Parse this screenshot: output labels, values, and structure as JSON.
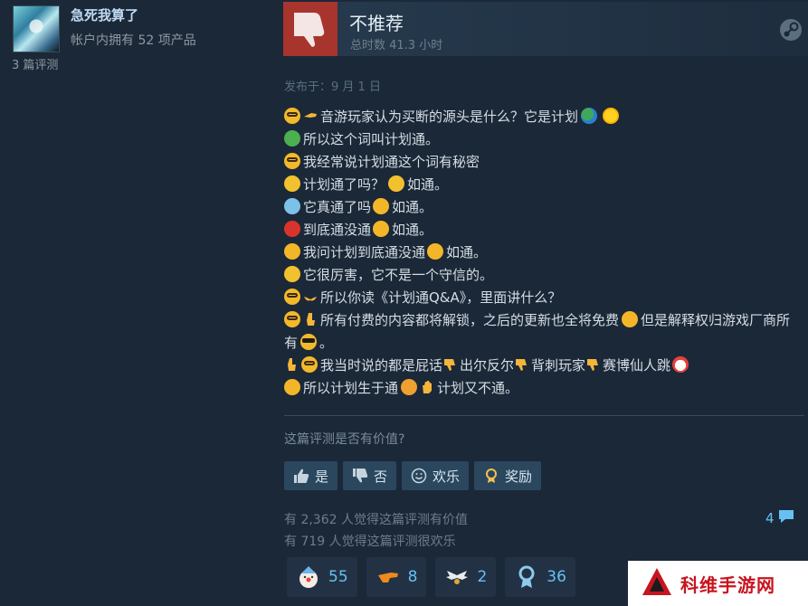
{
  "author": {
    "name": "急死我算了",
    "products": "帐户内拥有 52 项产品",
    "reviews": "3 篇评测"
  },
  "review": {
    "verdict": "不推荐",
    "hours": "总时数 41.3 小时",
    "posted": "发布于：9 月 1 日",
    "lines": [
      "音游玩家认为买断的源头是什么？它是计划",
      "所以这个词叫计划通。",
      "我经常说计划通这个词有秘密",
      "计划通了吗？",
      "如通。",
      "它真通了吗",
      "如通。",
      "到底通没通",
      "如通。",
      "我问计划到底通没通",
      "如通。",
      "它很厉害，它不是一个守信的。",
      "所以你读《计划通Q&A》，里面讲什么？",
      "所有付费的内容都将解锁，之后的更新也全将免费",
      "但是解释权归游戏厂商所有",
      "。",
      "我当时说的都是屁话",
      "出尔反尔",
      "背刺玩家",
      "赛博仙人跳",
      "所以计划生于通",
      "计划又不通。"
    ]
  },
  "helpful": {
    "question": "这篇评测是否有价值?",
    "yes": "是",
    "no": "否",
    "funny": "欢乐",
    "award": "奖励",
    "helpful_count": "有 2,362 人觉得这篇评测有价值",
    "funny_count": "有 719 人觉得这篇评测很欢乐",
    "comments": "4"
  },
  "awards": [
    {
      "icon": "clown-award-icon",
      "count": "55"
    },
    {
      "icon": "hand-point-award-icon",
      "count": "8"
    },
    {
      "icon": "wings-award-icon",
      "count": "2"
    },
    {
      "icon": "ribbon-award-icon",
      "count": "36"
    }
  ],
  "watermark": {
    "text": "科维手游网"
  },
  "colors": {
    "background": "#1b2838",
    "thumb_down": "#a8342e",
    "link": "#66c0f4",
    "button": "#2a475e",
    "watermark_red": "#c8141f"
  }
}
